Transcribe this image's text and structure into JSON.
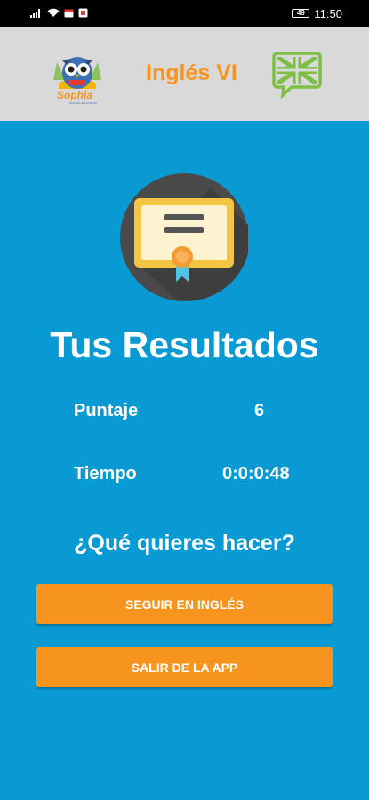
{
  "status_bar": {
    "battery": "49",
    "time": "11:50",
    "icons": [
      "signal-icon",
      "wifi-icon",
      "calendar-icon",
      "notification-icon",
      "battery-icon"
    ]
  },
  "header": {
    "title": "Inglés VI",
    "logo_text": "Sophia",
    "logo_subtext": "SCHOOL EDUCATION",
    "flag_icon": "uk-flag-speech-icon"
  },
  "results": {
    "icon": "certificate-icon",
    "title": "Tus Resultados",
    "score_label": "Puntaje",
    "score_value": "6",
    "time_label": "Tiempo",
    "time_value": "0:0:0:48"
  },
  "actions": {
    "question": "¿Qué quieres hacer?",
    "continue_label": "SEGUIR EN INGLÉS",
    "exit_label": "SALIR DE LA APP"
  },
  "colors": {
    "background": "#0a9ad3",
    "header_bg": "#d9d9d9",
    "accent_orange": "#f7941d",
    "flag_green": "#7dbf42"
  }
}
